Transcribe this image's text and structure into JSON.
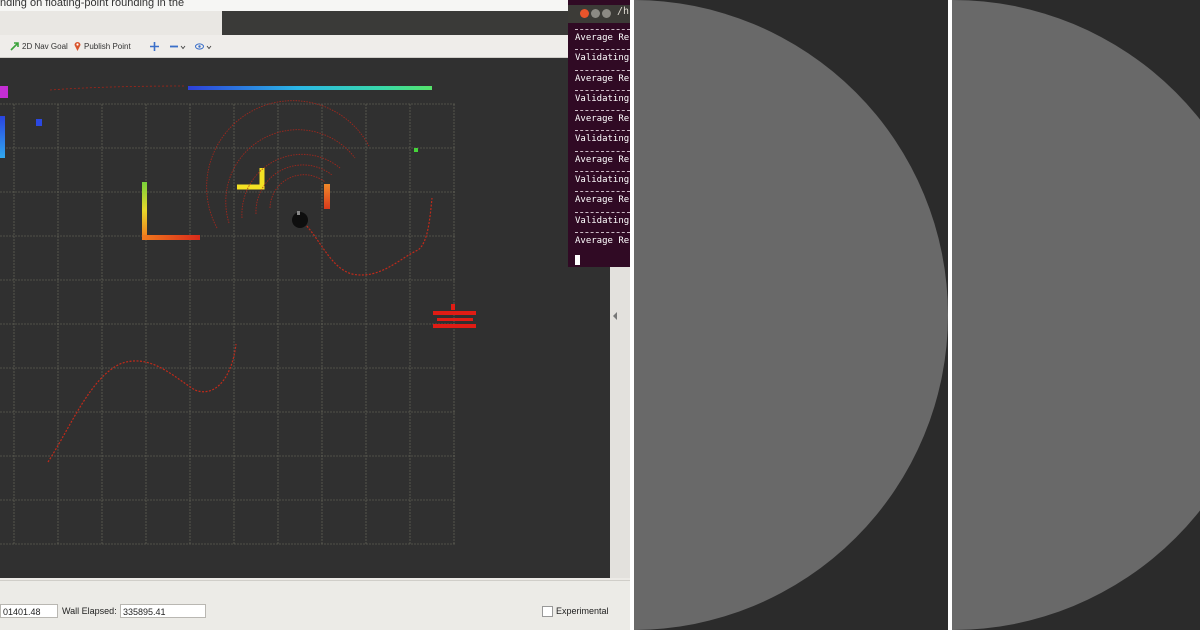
{
  "window": {
    "title": "nding on floating-point rounding in the"
  },
  "toolbar": {
    "nav_goal_label": "2D Nav Goal",
    "publish_point_label": "Publish Point"
  },
  "status": {
    "ros_time_value": "01401.48",
    "wall_elapsed_label": "Wall Elapsed:",
    "wall_elapsed_value": "335895.41",
    "experimental_label": "Experimental"
  },
  "terminal": {
    "title": "/h",
    "lines": [
      "Average Re",
      "Validating",
      "Average Re",
      "Validating",
      "Average Re",
      "Validating",
      "Average Re",
      "Validating",
      "Average Re",
      "Validating",
      "Average Re"
    ]
  },
  "colors": {
    "grid": "#7b7b6a",
    "laser": "#c02a1a",
    "terminal_bg": "#300a24",
    "panel_disc": "#696969",
    "panel_bg": "#2b2b2b"
  },
  "icons": [
    "nav-goal-arrow-icon",
    "map-pin-icon",
    "move-camera-icon",
    "minus-dropdown-icon",
    "eye-dropdown-icon",
    "robot-marker-icon",
    "close-icon",
    "minimize-icon",
    "maximize-icon"
  ]
}
